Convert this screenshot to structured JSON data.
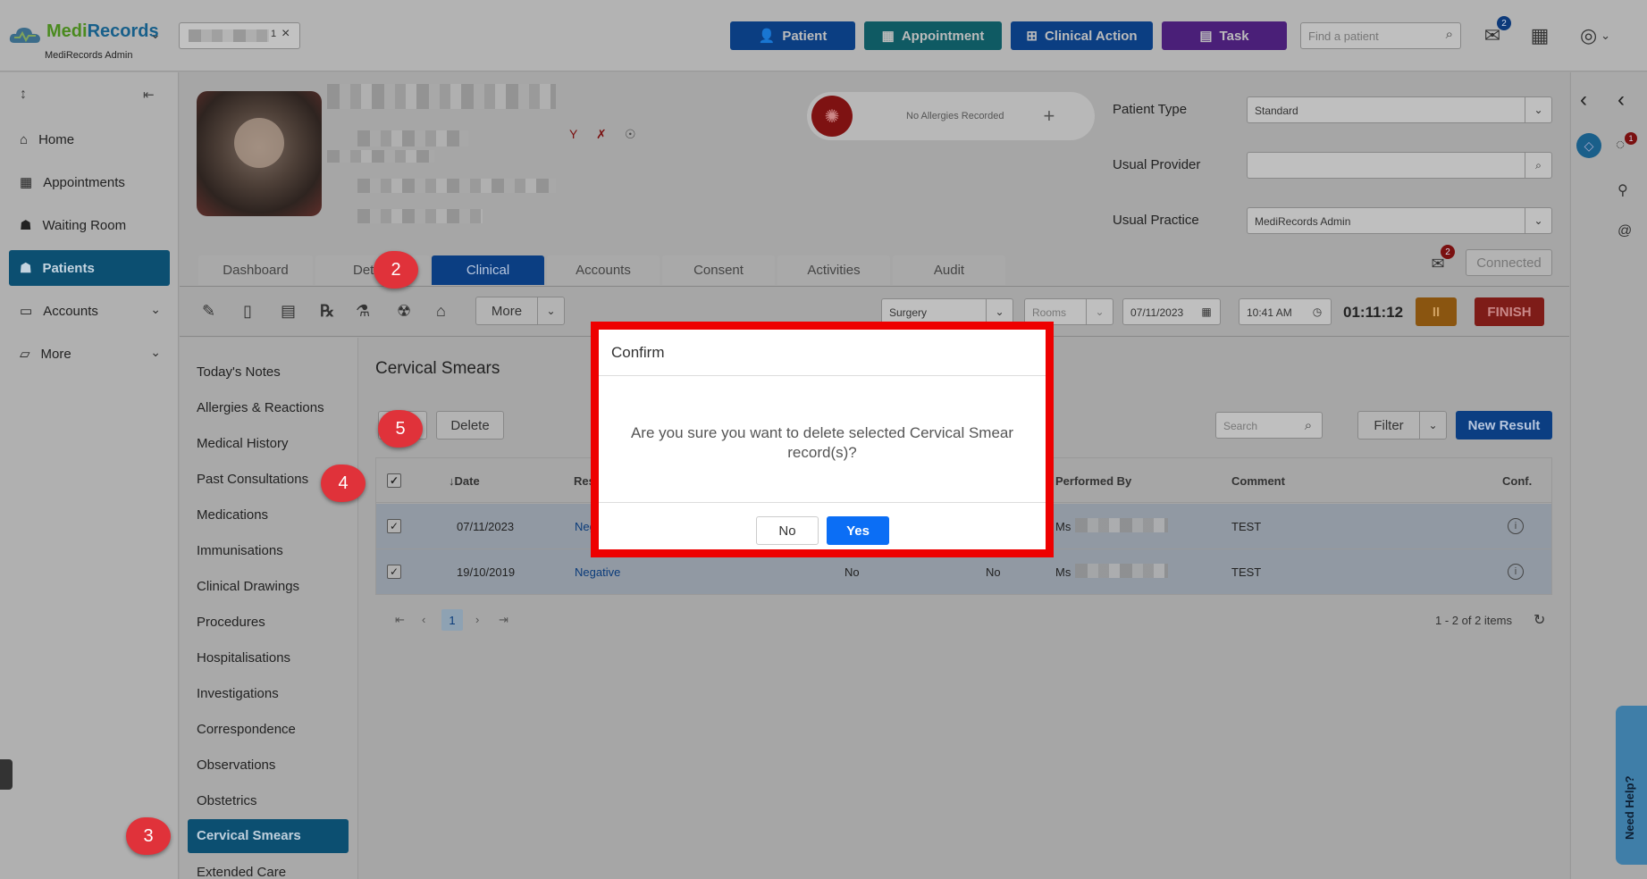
{
  "app": {
    "logo": "MediRecords",
    "subtitle": "MediRecords Admin",
    "tab_count": "1",
    "tab_close": "×"
  },
  "topbar": {
    "patient": "Patient",
    "appointment": "Appointment",
    "clinical_action": "Clinical Action",
    "task": "Task",
    "search_placeholder": "Find a patient",
    "mail_badge": "2"
  },
  "sidebar": {
    "items": [
      {
        "label": "Home"
      },
      {
        "label": "Appointments"
      },
      {
        "label": "Waiting Room"
      },
      {
        "label": "Patients"
      },
      {
        "label": "Accounts"
      },
      {
        "label": "More"
      }
    ]
  },
  "patient": {
    "allergies": "No Allergies Recorded",
    "patient_type_label": "Patient Type",
    "patient_type_value": "Standard",
    "usual_provider_label": "Usual Provider",
    "usual_provider_value": "",
    "usual_practice_label": "Usual Practice",
    "usual_practice_value": "MediRecords Admin",
    "mail_badge": "2",
    "connected": "Connected"
  },
  "tabs": [
    "Dashboard",
    "Det",
    "Clinical",
    "Accounts",
    "Consent",
    "Activities",
    "Audit"
  ],
  "toolbar": {
    "more": "More",
    "location": "Surgery",
    "rooms": "Rooms",
    "date": "07/11/2023",
    "time": "10:41 AM",
    "timer": "01:11:12",
    "pause": "II",
    "finish": "FINISH"
  },
  "subnav": [
    "Today's Notes",
    "Allergies & Reactions",
    "Medical History",
    "Past Consultations",
    "Medications",
    "Immunisations",
    "Clinical Drawings",
    "Procedures",
    "Hospitalisations",
    "Investigations",
    "Correspondence",
    "Observations",
    "Obstetrics",
    "Cervical Smears",
    "Extended Care"
  ],
  "content": {
    "title": "Cervical Smears",
    "delete": "Delete",
    "search_placeholder": "Search",
    "filter": "Filter",
    "new_result": "New Result",
    "columns": {
      "date": "↓Date",
      "result": "Res",
      "performed_by": "Performed By",
      "comment": "Comment",
      "conf": "Conf."
    },
    "rows": [
      {
        "date": "07/11/2023",
        "result": "Neg",
        "col3": "",
        "col4": "",
        "performed_by": "Ms",
        "comment": "TEST"
      },
      {
        "date": "19/10/2019",
        "result": "Negative",
        "col3": "No",
        "col4": "No",
        "performed_by": "Ms",
        "comment": "TEST"
      }
    ],
    "page": "1",
    "items_summary": "1 - 2 of 2 items"
  },
  "modal": {
    "title": "Confirm",
    "message": "Are you sure you want to delete selected Cervical Smear record(s)?",
    "no": "No",
    "yes": "Yes"
  },
  "markers": [
    "2",
    "3",
    "4",
    "5"
  ],
  "rightrail": {
    "chat_badge": "1",
    "help": "Need Help?"
  },
  "colors": {
    "patient_btn": "#0b3e82",
    "appointment_btn": "#0f5a63",
    "clinical_btn": "#0b3e82",
    "task_btn": "#4a1f78",
    "active_nav": "#0c4f71",
    "modal_border": "#ee0000",
    "yes_btn": "#0b6ef5",
    "marker": "#e0323a"
  }
}
